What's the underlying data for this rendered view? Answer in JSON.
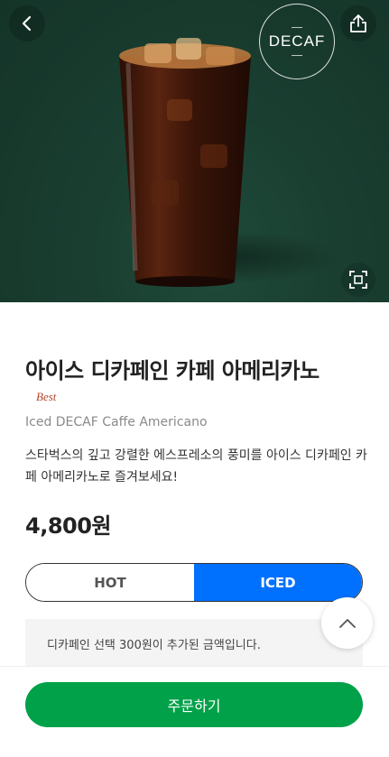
{
  "hero": {
    "badge_text": "DECAF",
    "background_color": "#173a2d"
  },
  "icons": {
    "back": "chevron-left-icon",
    "share": "share-icon",
    "fullscreen": "fullscreen-icon",
    "scroll_top": "chevron-up-icon"
  },
  "product": {
    "name_ko": "아이스 디카페인 카페 아메리카노",
    "badge": "Best",
    "name_en": "Iced DECAF Caffe Americano",
    "description": "스타벅스의 깊고 강렬한 에스프레소의 풍미를 아이스 디카페인 카페 아메리카노로 즐겨보세요!",
    "price": "4,800원"
  },
  "temperature": {
    "options": [
      "HOT",
      "ICED"
    ],
    "selected": "ICED",
    "accent": "#0071ff"
  },
  "notice": {
    "text": "디카페인 선택 300원이 추가된 금액입니다."
  },
  "order": {
    "label": "주문하기",
    "color": "#00a148"
  }
}
